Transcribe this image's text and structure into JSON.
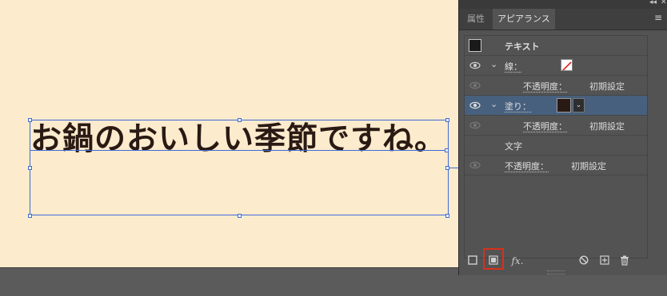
{
  "canvas": {
    "text": "お鍋のおいしい季節ですね。"
  },
  "panel": {
    "tabs": [
      {
        "label": "属性"
      },
      {
        "label": "アピアランス"
      }
    ],
    "header_row": {
      "label": "テキスト"
    },
    "stroke_row": {
      "label": "線："
    },
    "stroke_opacity_row": {
      "label": "不透明度：",
      "value": "初期設定"
    },
    "fill_row": {
      "label": "塗り："
    },
    "fill_opacity_row": {
      "label": "不透明度：",
      "value": "初期設定"
    },
    "character_row": {
      "label": "文字"
    },
    "char_opacity_row": {
      "label": "不透明度：",
      "value": "初期設定"
    },
    "fx_label": "fx."
  },
  "colors": {
    "canvas_bg": "#fdebcd",
    "text_fill": "#2a1a14",
    "selection": "#3d6bd8",
    "panel_bg": "#535353",
    "selected_row": "#47607d",
    "highlight": "#d9301c"
  }
}
